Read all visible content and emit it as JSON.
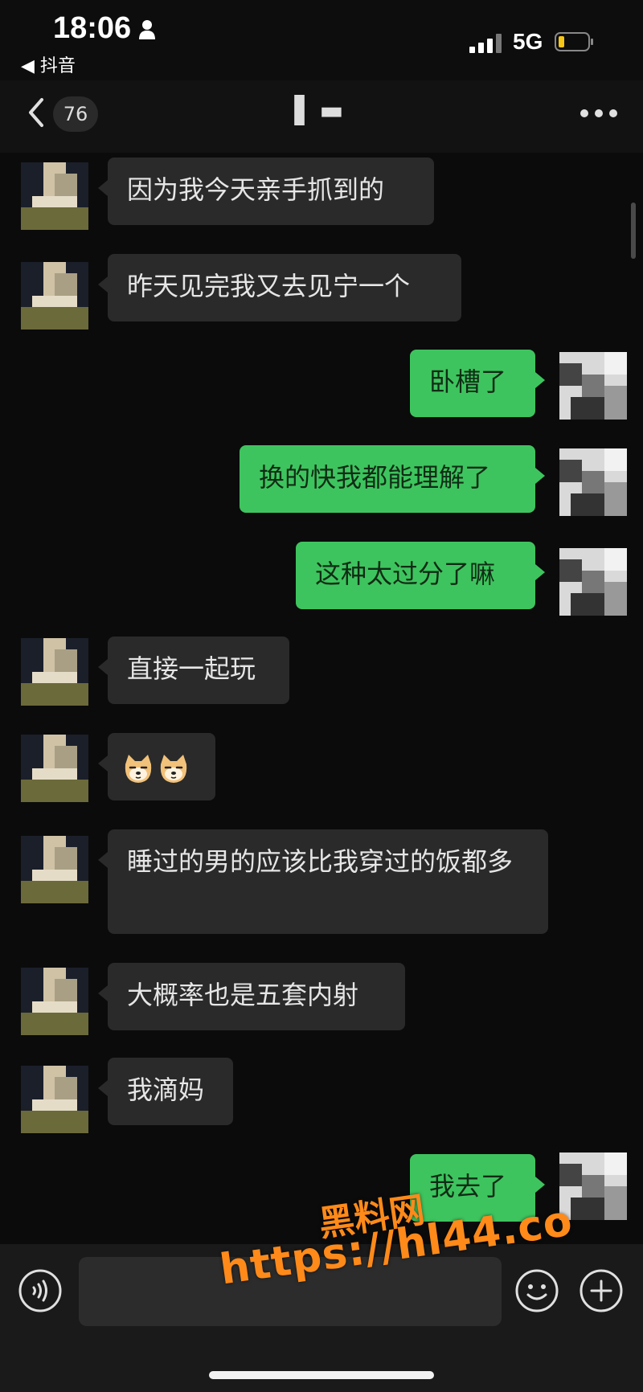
{
  "status_bar": {
    "time": "18:06",
    "back_app": "◀ 抖音",
    "network": "5G",
    "battery_color": "#f5c518"
  },
  "header": {
    "back_icon": "chevron-left-icon",
    "unread_count": "76",
    "title": "▌▬",
    "more_icon": "more-dots-icon"
  },
  "messages": [
    {
      "side": "in",
      "text": "因为我今天亲手抓到的"
    },
    {
      "side": "in",
      "text": "昨天见完我又去见宁一个"
    },
    {
      "side": "out",
      "text": "卧槽了"
    },
    {
      "side": "out",
      "text": "换的快我都能理解了"
    },
    {
      "side": "out",
      "text": "这种太过分了嘛"
    },
    {
      "side": "in",
      "text": "直接一起玩"
    },
    {
      "side": "in",
      "text": "",
      "emoji": "doge-emoji",
      "emoji_count": 2
    },
    {
      "side": "in",
      "text": "睡过的男的应该比我穿过的饭都多"
    },
    {
      "side": "in",
      "text": "大概率也是五套内射"
    },
    {
      "side": "in",
      "text": "我滴妈"
    },
    {
      "side": "out",
      "text": "我去了"
    }
  ],
  "input_bar": {
    "voice_icon": "voice-icon",
    "input_value": "",
    "emoji_icon": "emoji-icon",
    "plus_icon": "plus-icon"
  },
  "watermark": {
    "line1": "黑料网",
    "line2": "https://hl44.co"
  },
  "colors": {
    "outgoing_bubble": "#3ec45e",
    "incoming_bubble": "#2a2a2a",
    "background": "#0b0b0b",
    "watermark": "#ff8a1a"
  }
}
